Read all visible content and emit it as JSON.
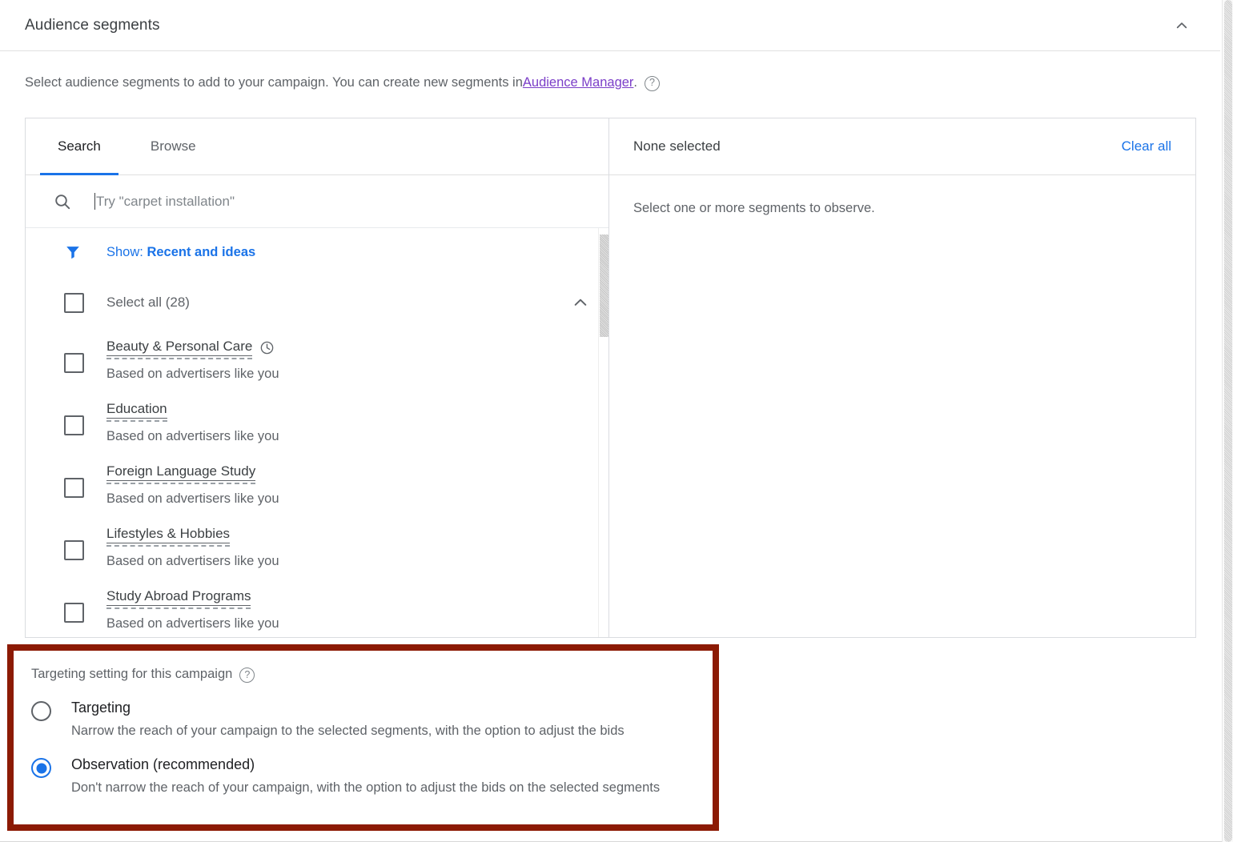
{
  "header": {
    "title": "Audience segments",
    "collapse_icon": "chevron-up-icon"
  },
  "description": {
    "text_before": "Select audience segments to add to your campaign. You can create new segments in ",
    "link_label": "Audience Manager",
    "text_after": ".",
    "help_icon": "help-circle-icon",
    "link_color": "#7b3ec8"
  },
  "selector": {
    "tabs": [
      {
        "label": "Search",
        "active": true
      },
      {
        "label": "Browse",
        "active": false
      }
    ],
    "search": {
      "icon": "search-icon",
      "placeholder": "Try \"carpet installation\"",
      "value": ""
    },
    "filter": {
      "icon": "filter-icon",
      "prefix": "Show: ",
      "value": "Recent and ideas"
    },
    "select_all": {
      "label": "Select all (28)",
      "checked": false,
      "collapse_icon": "chevron-up-icon"
    },
    "segments": [
      {
        "name": "Beauty & Personal Care",
        "sub": "Based on advertisers like you",
        "badge_icon": "clock-icon",
        "checked": false
      },
      {
        "name": "Education",
        "sub": "Based on advertisers like you",
        "badge_icon": "",
        "checked": false
      },
      {
        "name": "Foreign Language Study",
        "sub": "Based on advertisers like you",
        "badge_icon": "",
        "checked": false
      },
      {
        "name": "Lifestyles & Hobbies",
        "sub": "Based on advertisers like you",
        "badge_icon": "",
        "checked": false
      },
      {
        "name": "Study Abroad Programs",
        "sub": "Based on advertisers like you",
        "badge_icon": "",
        "checked": false
      }
    ],
    "selected_panel": {
      "title": "None selected",
      "clear_all_label": "Clear all",
      "empty_text": "Select one or more segments to observe."
    }
  },
  "targeting": {
    "label": "Targeting setting for this campaign",
    "help_icon": "help-circle-icon",
    "highlight_color": "#8c1a04",
    "options": [
      {
        "title": "Targeting",
        "desc": "Narrow the reach of your campaign to the selected segments, with the option to adjust the bids",
        "selected": false
      },
      {
        "title": "Observation (recommended)",
        "desc": "Don't narrow the reach of your campaign, with the option to adjust the bids on the selected segments",
        "selected": true
      }
    ]
  },
  "colors": {
    "accent_blue": "#1a73e8",
    "text_primary": "#202124",
    "text_secondary": "#5f6368",
    "border": "#dadce0"
  }
}
